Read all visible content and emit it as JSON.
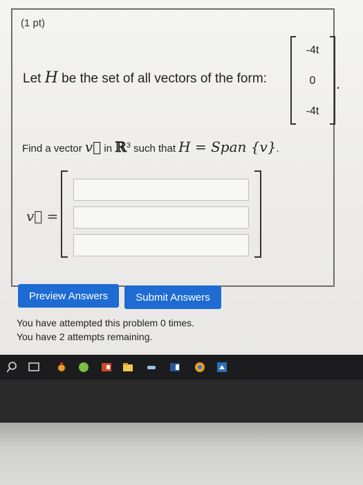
{
  "problem": {
    "points": "(1 pt)",
    "prompt_prefix": "Let ",
    "set_var": "H",
    "prompt_suffix": " be the set of all vectors of the form:",
    "vector": [
      "-4t",
      "0",
      "-4t"
    ],
    "find_prefix": "Find a vector ",
    "vec_symbol": "v⃗",
    "find_in": " in ",
    "space_symbol": "ℝ",
    "space_exp": "3",
    "find_such": " such that ",
    "span_equation": "H = Span {v}",
    "period": "."
  },
  "answer": {
    "label": "v⃗ =",
    "fields": [
      {
        "value": "",
        "placeholder": ""
      },
      {
        "value": "",
        "placeholder": ""
      },
      {
        "value": "",
        "placeholder": ""
      }
    ]
  },
  "buttons": {
    "preview": "Preview Answers",
    "submit": "Submit Answers"
  },
  "status": {
    "attempted": "You have attempted this problem 0 times.",
    "remaining": "You have 2 attempts remaining."
  },
  "taskbar_icons": [
    "search-icon",
    "task-view-icon",
    "app-icon",
    "browser-icon",
    "powerpoint-icon",
    "file-explorer-icon",
    "edge-icon",
    "word-icon",
    "chrome-icon",
    "pinned-app-icon"
  ],
  "colors": {
    "button_blue": "#1d6bd3",
    "taskbar": "#1c1c1e"
  }
}
